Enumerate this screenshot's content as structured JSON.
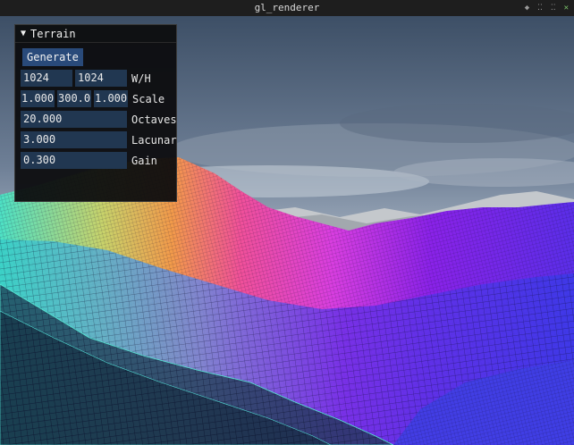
{
  "window": {
    "title": "gl_renderer",
    "controls": [
      "pin-icon",
      "minimize-icon",
      "maximize-icon",
      "close-icon"
    ],
    "control_glyphs": [
      "◆",
      "⁚⁚",
      "⁚⁚",
      "✕"
    ]
  },
  "panel": {
    "title": "Terrain",
    "generate_label": "Generate",
    "wh": {
      "width": "1024",
      "height": "1024",
      "label": "W/H"
    },
    "scale": {
      "x": "1.000",
      "y": "300.0",
      "z": "1.000",
      "label": "Scale"
    },
    "octaves": {
      "value": "20.000",
      "label": "Octaves"
    },
    "lacunarity": {
      "value": "3.000",
      "label": "Lacunar"
    },
    "gain": {
      "value": "0.300",
      "label": "Gain"
    }
  },
  "colors": {
    "accent_button": "#294a7a",
    "field_bg": "#213751",
    "terrain_cyan": "#3ce0d0",
    "terrain_magenta": "#e23fd8",
    "terrain_violet": "#6a1fe6",
    "terrain_blue": "#3b3be8"
  }
}
